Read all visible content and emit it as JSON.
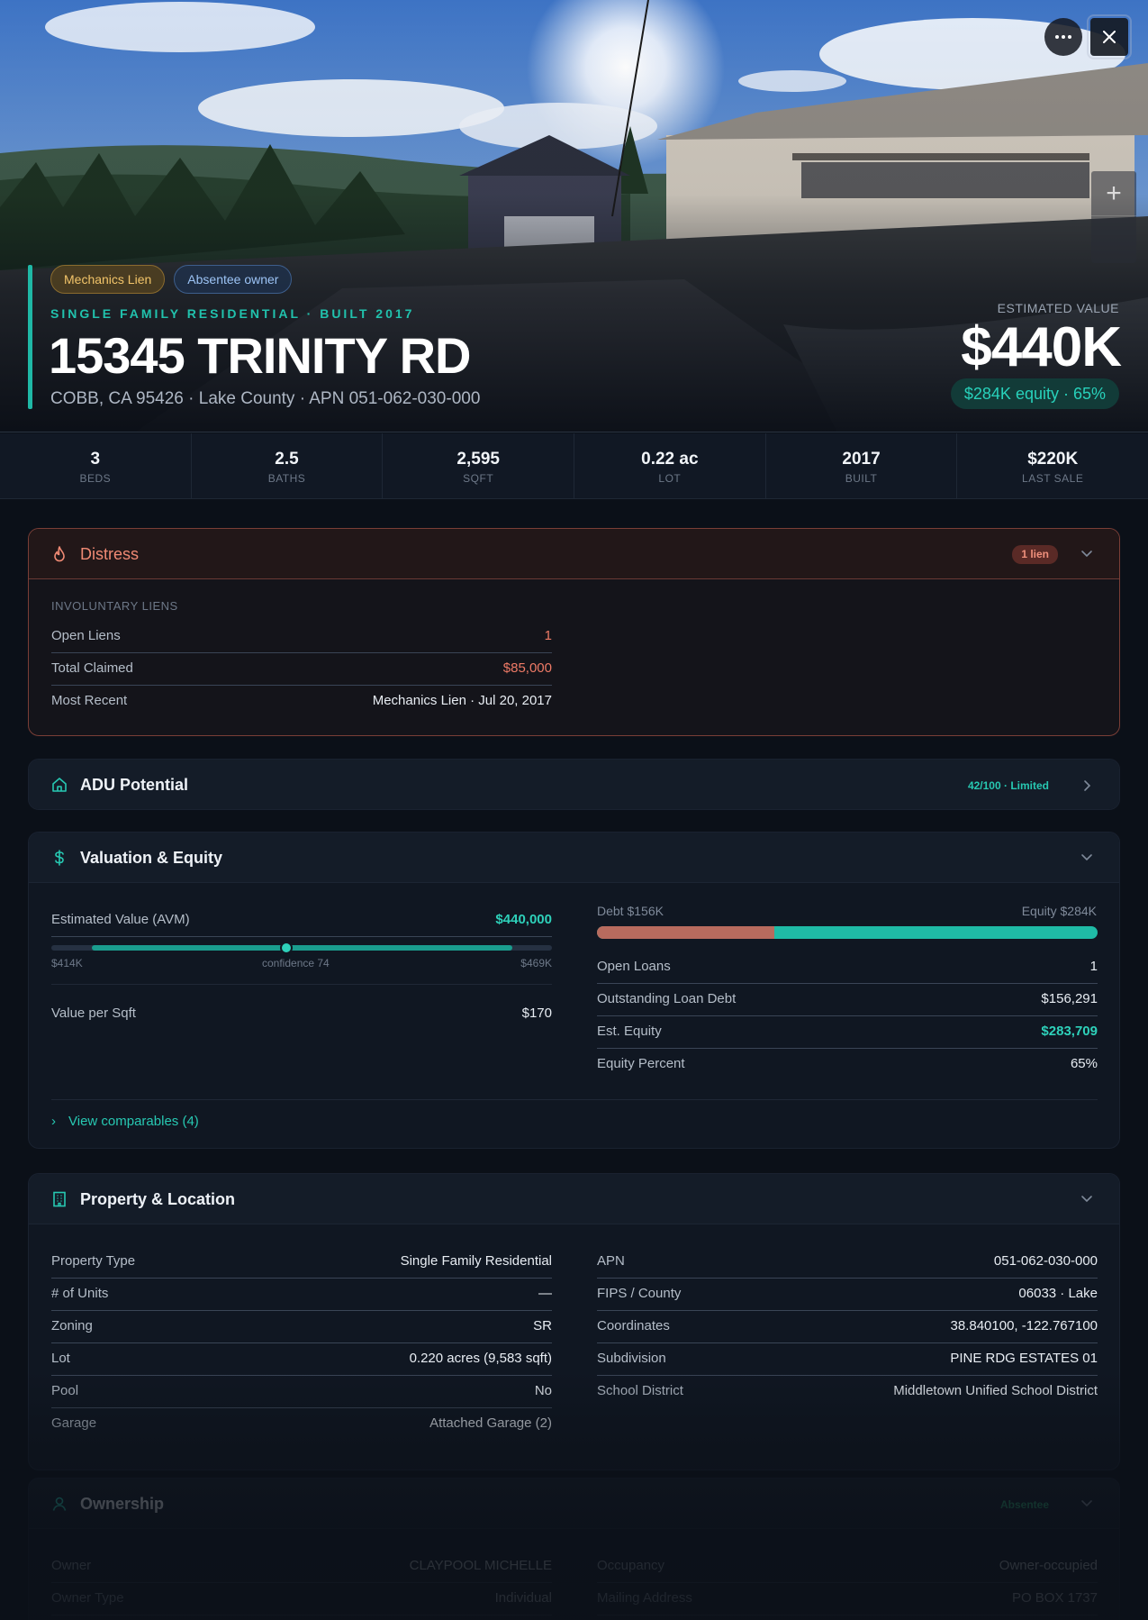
{
  "hero": {
    "tags": [
      "Mechanics Lien",
      "Absentee owner"
    ],
    "subtype": "SINGLE FAMILY RESIDENTIAL · BUILT 2017",
    "address": "15345 TRINITY RD",
    "location": "COBB, CA 95426 · Lake County · APN 051-062-030-000",
    "estimated_label": "ESTIMATED VALUE",
    "estimated_value": "$440K",
    "equity_pill": "$284K equity · 65%",
    "more_icon": "ellipsis-icon",
    "close_icon": "close-icon",
    "zoom_in": "+"
  },
  "stats": [
    {
      "value": "3",
      "label": "BEDS"
    },
    {
      "value": "2.5",
      "label": "BATHS"
    },
    {
      "value": "2,595",
      "label": "SQFT"
    },
    {
      "value": "0.22 ac",
      "label": "LOT"
    },
    {
      "value": "2017",
      "label": "BUILT"
    },
    {
      "value": "$220K",
      "label": "LAST SALE"
    }
  ],
  "distress": {
    "title": "Distress",
    "badge": "1 lien",
    "section": "INVOLUNTARY LIENS",
    "rows": [
      {
        "k": "Open Liens",
        "v": "1"
      },
      {
        "k": "Total Claimed",
        "v": "$85,000"
      },
      {
        "k": "Most Recent",
        "v": "Mechanics Lien · Jul 20, 2017"
      }
    ]
  },
  "adu": {
    "title": "ADU Potential",
    "score": "42/100 · Limited"
  },
  "valuation": {
    "title": "Valuation & Equity",
    "avm_label": "Estimated Value (AVM)",
    "avm_value": "$440,000",
    "range_low": "$414K",
    "confidence": "confidence 74",
    "range_high": "$469K",
    "range_level": 0.47,
    "ppsf_label": "Value per Sqft",
    "ppsf_value": "$170",
    "debt_label": "Debt $156K",
    "equity_label": "Equity $284K",
    "debt_fraction": 0.355,
    "rows": [
      {
        "k": "Open Loans",
        "v": "1"
      },
      {
        "k": "Outstanding Loan Debt",
        "v": "$156,291"
      },
      {
        "k": "Est. Equity",
        "v": "$283,709"
      },
      {
        "k": "Equity Percent",
        "v": "65%"
      }
    ],
    "comps_link": "View comparables (4)"
  },
  "property": {
    "title": "Property & Location",
    "left": [
      {
        "k": "Property Type",
        "v": "Single Family Residential"
      },
      {
        "k": "# of Units",
        "v": "—"
      },
      {
        "k": "Zoning",
        "v": "SR"
      },
      {
        "k": "Lot",
        "v": "0.220 acres (9,583 sqft)"
      },
      {
        "k": "Pool",
        "v": "No"
      },
      {
        "k": "Garage",
        "v": "Attached Garage (2)"
      }
    ],
    "right": [
      {
        "k": "APN",
        "v": "051-062-030-000"
      },
      {
        "k": "FIPS / County",
        "v": "06033 · Lake"
      },
      {
        "k": "Coordinates",
        "v": "38.840100, -122.767100"
      },
      {
        "k": "Subdivision",
        "v": "PINE RDG ESTATES 01"
      },
      {
        "k": "School District",
        "v": "Middletown Unified School District"
      }
    ]
  },
  "ownership": {
    "title": "Ownership",
    "badge": "Absentee",
    "left": [
      {
        "k": "Owner",
        "v": "CLAYPOOL MICHELLE"
      },
      {
        "k": "Owner Type",
        "v": "Individual"
      }
    ],
    "right": [
      {
        "k": "Occupancy",
        "v": "Owner-occupied"
      },
      {
        "k": "Mailing Address",
        "v": "PO BOX 1737"
      }
    ]
  },
  "colors": {
    "accent": "#1fb8a6",
    "distress": "#f08a74",
    "debt": "#b86b5e",
    "background": "#0b1018"
  }
}
